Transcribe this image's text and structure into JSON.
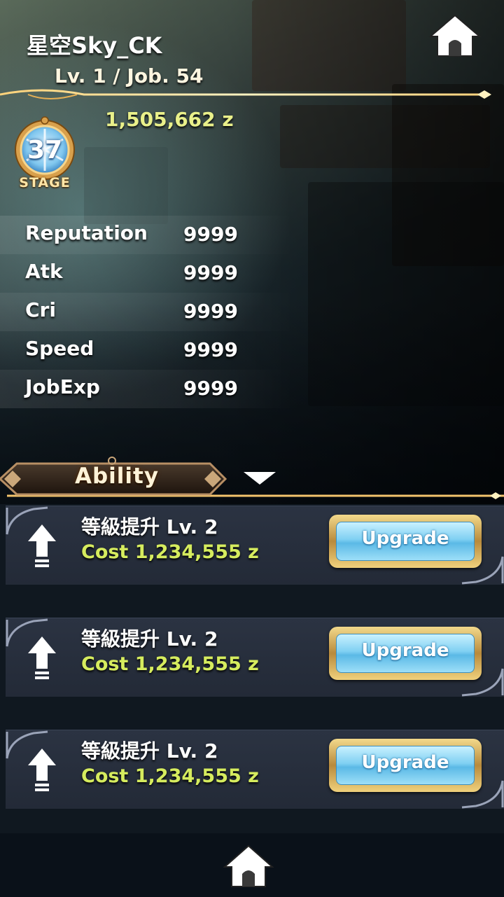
{
  "player": {
    "name": "星空Sky_CK",
    "level_line": "Lv. 1 / Job. 54",
    "zeny": "1,505,662 z"
  },
  "stage": {
    "number": "37",
    "label": "STAGE"
  },
  "stats": [
    {
      "label": "Reputation",
      "value": "9999"
    },
    {
      "label": "Atk",
      "value": "9999"
    },
    {
      "label": "Cri",
      "value": "9999"
    },
    {
      "label": "Speed",
      "value": "9999"
    },
    {
      "label": "JobExp",
      "value": "9999"
    }
  ],
  "ability": {
    "title": "Ability"
  },
  "upgrades": [
    {
      "title": "等級提升 Lv. 2",
      "cost": "Cost 1,234,555 z",
      "button": "Upgrade"
    },
    {
      "title": "等級提升 Lv. 2",
      "cost": "Cost 1,234,555 z",
      "button": "Upgrade"
    },
    {
      "title": "等級提升 Lv. 2",
      "cost": "Cost 1,234,555 z",
      "button": "Upgrade"
    }
  ],
  "icons": {
    "home_top": "home-icon",
    "home_bottom": "home-icon",
    "stage_badge": "snowflake-icon",
    "upgrade_arrow": "arrow-up-icon",
    "dropdown": "triangle-down-icon"
  },
  "colors": {
    "gold": "#f0c060",
    "zeny": "#e9f08a",
    "cost": "#d6ec5e",
    "button_face": "#7fd0f2"
  }
}
